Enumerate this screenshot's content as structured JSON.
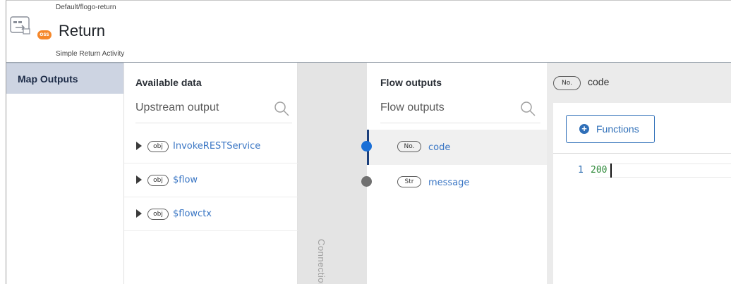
{
  "header": {
    "breadcrumb": "Default/flogo-return",
    "badge": "OSS",
    "title": "Return",
    "subtitle": "Simple Return Activity"
  },
  "nav": {
    "items": [
      {
        "label": "Map Outputs",
        "active": true
      }
    ]
  },
  "available_data": {
    "title": "Available data",
    "search_placeholder": "Upstream output",
    "items": [
      {
        "type": "obj",
        "label": "InvokeRESTService"
      },
      {
        "type": "obj",
        "label": "$flow"
      },
      {
        "type": "obj",
        "label": "$flowctx"
      }
    ]
  },
  "connections": {
    "label": "Connections"
  },
  "flow_outputs": {
    "title": "Flow outputs",
    "search_placeholder": "Flow outputs",
    "items": [
      {
        "type": "No.",
        "label": "code",
        "mapped": true,
        "selected": true
      },
      {
        "type": "Str",
        "label": "message",
        "mapped": false,
        "selected": false
      }
    ]
  },
  "editor": {
    "target_type": "No.",
    "target_name": "code",
    "functions_label": "Functions",
    "line_number": "1",
    "code": "200"
  },
  "colors": {
    "accent": "#2f6fb8",
    "mapped_dot": "#1a6fd6",
    "unmapped_dot": "#707070",
    "nav_active": "#cdd4e2",
    "badge": "#f5872a"
  }
}
